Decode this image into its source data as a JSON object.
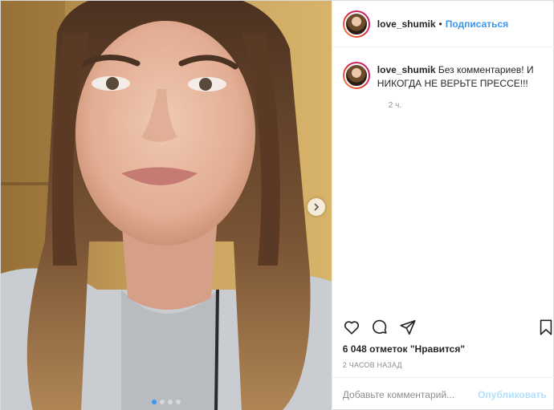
{
  "post": {
    "username": "love_shumik",
    "separator": "•",
    "follow_label": "Подписаться",
    "caption": "Без комментариев! И НИКОГДА НЕ ВЕРЬТЕ ПРЕССЕ!!!",
    "caption_time": "2 ч.",
    "likes_text": "6 048 отметок \"Нравится\"",
    "posted_ago": "2 ЧАСОВ НАЗАД"
  },
  "comment_box": {
    "placeholder": "Добавьте комментарий...",
    "publish_label": "Опубликовать"
  },
  "carousel": {
    "slides": 4,
    "active_index": 0
  },
  "icons": {
    "like": "heart-icon",
    "comment": "comment-icon",
    "share": "share-icon",
    "save": "bookmark-icon",
    "next": "chevron-right-icon"
  },
  "colors": {
    "link": "#3897f0",
    "publish_disabled": "#b2dffc",
    "muted": "#8e8e8e",
    "text": "#262626"
  }
}
